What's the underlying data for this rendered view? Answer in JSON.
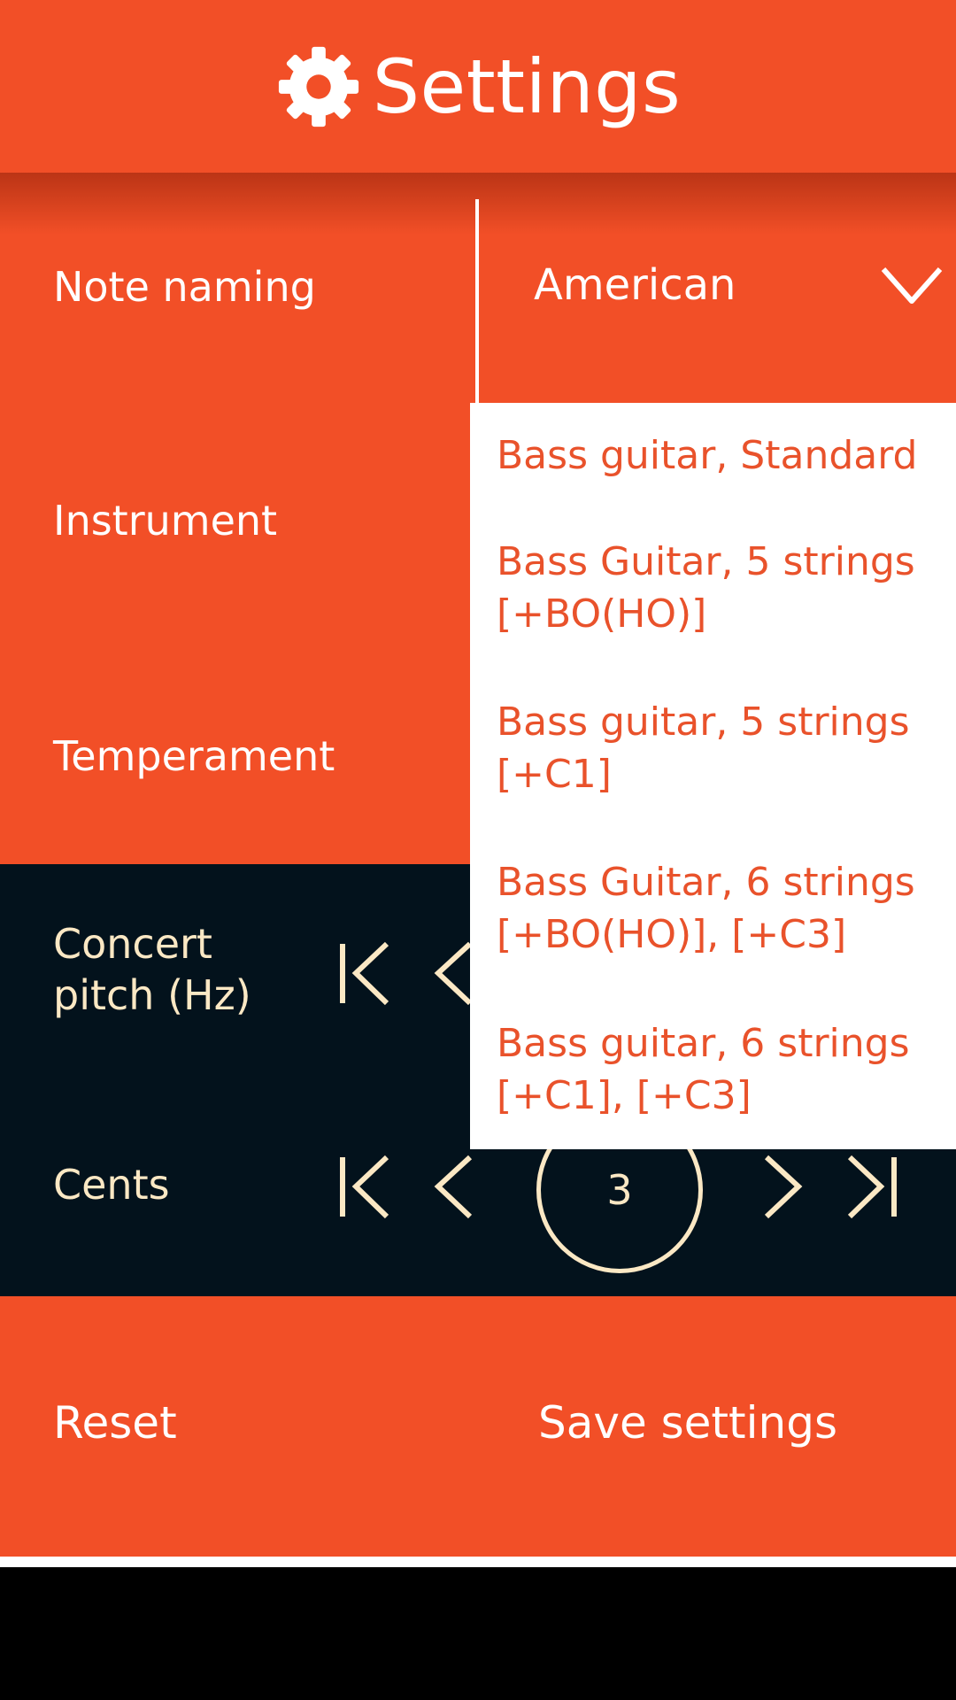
{
  "header": {
    "title": "Settings",
    "icon": "gear-icon"
  },
  "settings": {
    "note_naming": {
      "label": "Note naming",
      "value": "American"
    },
    "instrument": {
      "label": "Instrument"
    },
    "temperament": {
      "label": "Temperament"
    },
    "concert_pitch": {
      "label_line1": "Concert",
      "label_line2": "pitch (Hz)"
    },
    "cents": {
      "label": "Cents",
      "value": "3"
    }
  },
  "dropdown": {
    "items": [
      {
        "line1": "Bass guitar, Standard",
        "line2": ""
      },
      {
        "line1": "Bass Guitar, 5 strings",
        "line2": "[+BO(HO)]"
      },
      {
        "line1": "Bass guitar, 5 strings",
        "line2": "[+C1]"
      },
      {
        "line1": "Bass Guitar, 6 strings",
        "line2": "[+BO(HO)], [+C3]"
      },
      {
        "line1": "Bass guitar, 6 strings",
        "line2": "[+C1], [+C3]"
      }
    ]
  },
  "footer": {
    "reset_label": "Reset",
    "save_label": "Save settings"
  },
  "colors": {
    "accent": "#f24f27",
    "dark": "#03121c",
    "cream": "#fbe8c4",
    "white": "#ffffff"
  }
}
